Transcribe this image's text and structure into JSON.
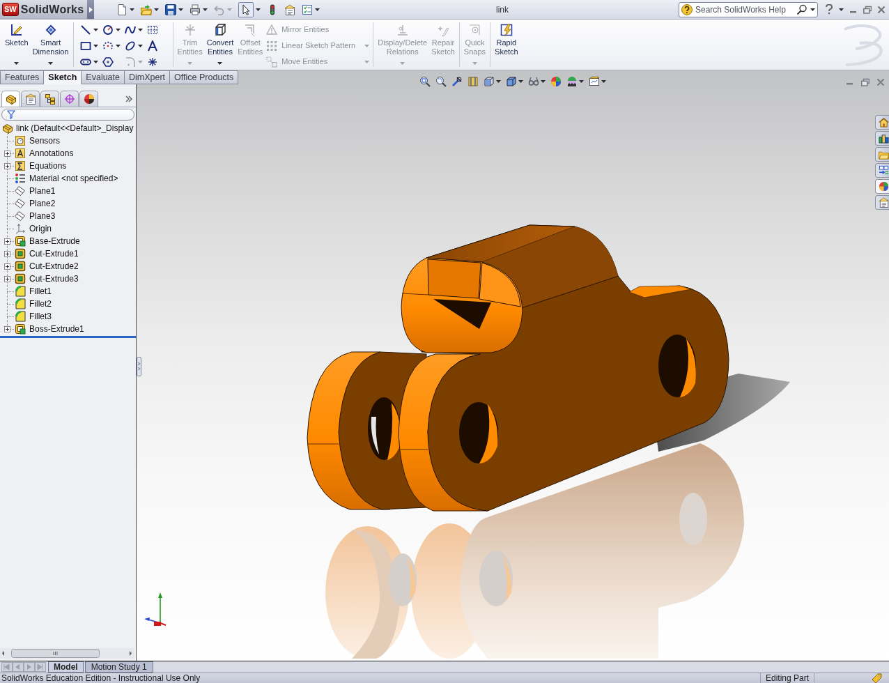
{
  "title_bar": {
    "logo_mark": "SW",
    "logo_text": "SolidWorks",
    "title": "link",
    "search": {
      "placeholder": "Search SolidWorks Help"
    }
  },
  "quick_access": [
    {
      "kind": "new",
      "menu": true,
      "disabled": false,
      "on": false
    },
    {
      "kind": "open",
      "menu": true,
      "disabled": false,
      "on": false
    },
    {
      "kind": "save",
      "menu": true,
      "disabled": false,
      "on": false
    },
    {
      "kind": "print",
      "menu": true,
      "disabled": false,
      "on": false
    },
    {
      "kind": "undo",
      "menu": true,
      "disabled": true,
      "on": false
    },
    {
      "kind": "select",
      "menu": true,
      "disabled": false,
      "on": true
    },
    {
      "kind": "rebuild",
      "menu": false,
      "disabled": false,
      "on": false
    },
    {
      "kind": "properties",
      "menu": false,
      "disabled": false,
      "on": false
    },
    {
      "kind": "options",
      "menu": true,
      "disabled": false,
      "on": false
    }
  ],
  "ribbon": {
    "sections": [
      {
        "kind": "buttons",
        "items": [
          {
            "kind": "sketch",
            "label": "Sketch",
            "disabled": false,
            "menu": true
          },
          {
            "kind": "dimension",
            "label": "Smart Dimension",
            "disabled": false,
            "menu": true
          }
        ]
      },
      {
        "kind": "tools",
        "items": [
          {
            "kind": "line",
            "disabled": false,
            "menu": true
          },
          {
            "kind": "circle",
            "disabled": false,
            "menu": true
          },
          {
            "kind": "spline",
            "disabled": false,
            "menu": true
          },
          {
            "kind": "grid",
            "disabled": false,
            "menu": false
          },
          {
            "kind": "rectangle",
            "disabled": false,
            "menu": true
          },
          {
            "kind": "arc",
            "disabled": false,
            "menu": true
          },
          {
            "kind": "ellipse",
            "disabled": false,
            "menu": true
          },
          {
            "kind": "text",
            "disabled": false,
            "menu": false
          },
          {
            "kind": "slot",
            "disabled": false,
            "menu": true
          },
          {
            "kind": "polygon",
            "disabled": false,
            "menu": false
          },
          {
            "kind": "fillet",
            "disabled": true,
            "menu": true
          },
          {
            "kind": "point",
            "disabled": false,
            "menu": false
          }
        ]
      },
      {
        "kind": "buttons",
        "items": [
          {
            "kind": "trim",
            "label": "Trim Entities",
            "disabled": true,
            "menu": true
          },
          {
            "kind": "convert",
            "label": "Convert Entities",
            "disabled": false,
            "menu": true
          },
          {
            "kind": "offset",
            "label": "Offset Entities",
            "disabled": true,
            "menu": false
          },
          {
            "kind": "stack",
            "items": [
              {
                "kind": "mirror",
                "label": "Mirror Entities",
                "disabled": true,
                "menu": false
              },
              {
                "kind": "pattern",
                "label": "Linear Sketch Pattern",
                "disabled": true,
                "menu": true
              },
              {
                "kind": "move",
                "label": "Move Entities",
                "disabled": true,
                "menu": true
              }
            ]
          }
        ]
      },
      {
        "kind": "buttons",
        "items": [
          {
            "kind": "relations",
            "label": "Display/Delete Relations",
            "disabled": true,
            "menu": true
          },
          {
            "kind": "repair",
            "label": "Repair Sketch",
            "disabled": true,
            "menu": false
          }
        ]
      },
      {
        "kind": "buttons",
        "items": [
          {
            "kind": "snaps",
            "label": "Quick Snaps",
            "disabled": true,
            "menu": true
          }
        ]
      },
      {
        "kind": "buttons",
        "items": [
          {
            "kind": "rapid",
            "label": "Rapid Sketch",
            "disabled": false,
            "menu": false
          }
        ]
      }
    ],
    "tabs": [
      {
        "label": "Features",
        "selected": false
      },
      {
        "label": "Sketch",
        "selected": true
      },
      {
        "label": "Evaluate",
        "selected": false
      },
      {
        "label": "DimXpert",
        "selected": false
      },
      {
        "label": "Office Products",
        "selected": false
      }
    ]
  },
  "view_toolbar": [
    {
      "kind": "zoomfit",
      "menu": false
    },
    {
      "kind": "zoomarea",
      "menu": false
    },
    {
      "kind": "previous",
      "menu": false
    },
    {
      "kind": "section",
      "menu": false
    },
    {
      "kind": "orientation",
      "menu": true
    },
    {
      "kind": "display",
      "menu": true
    },
    {
      "kind": "visibility",
      "menu": true
    },
    {
      "kind": "appearance",
      "menu": false
    },
    {
      "kind": "scene",
      "menu": true
    },
    {
      "kind": "settings",
      "menu": true
    }
  ],
  "feature_manager": {
    "tabs": [
      {
        "kind": "tree",
        "selected": true
      },
      {
        "kind": "properties",
        "selected": false
      },
      {
        "kind": "configurations",
        "selected": false
      },
      {
        "kind": "dimxpert",
        "selected": false
      },
      {
        "kind": "display",
        "selected": false
      }
    ],
    "tree": {
      "label": "link (Default<<Default>_Display",
      "kind": "part",
      "children": [
        {
          "label": "Sensors",
          "kind": "sensors",
          "expandable": false
        },
        {
          "label": "Annotations",
          "kind": "annotations",
          "expandable": true
        },
        {
          "label": "Equations",
          "kind": "equations",
          "expandable": true
        },
        {
          "label": "Material <not specified>",
          "kind": "material",
          "expandable": false
        },
        {
          "label": "Plane1",
          "kind": "plane",
          "expandable": false
        },
        {
          "label": "Plane2",
          "kind": "plane",
          "expandable": false
        },
        {
          "label": "Plane3",
          "kind": "plane",
          "expandable": false
        },
        {
          "label": "Origin",
          "kind": "origin",
          "expandable": false
        },
        {
          "label": "Base-Extrude",
          "kind": "extrude",
          "expandable": true
        },
        {
          "label": "Cut-Extrude1",
          "kind": "cut",
          "expandable": true
        },
        {
          "label": "Cut-Extrude2",
          "kind": "cut",
          "expandable": true
        },
        {
          "label": "Cut-Extrude3",
          "kind": "cut",
          "expandable": true
        },
        {
          "label": "Fillet1",
          "kind": "fillet",
          "expandable": false
        },
        {
          "label": "Fillet2",
          "kind": "fillet",
          "expandable": false
        },
        {
          "label": "Fillet3",
          "kind": "fillet",
          "expandable": false
        },
        {
          "label": "Boss-Extrude1",
          "kind": "extrude",
          "expandable": true
        }
      ]
    }
  },
  "task_pane": [
    {
      "kind": "home",
      "selected": false
    },
    {
      "kind": "library",
      "selected": false
    },
    {
      "kind": "explorer",
      "selected": false
    },
    {
      "kind": "palette",
      "selected": false
    },
    {
      "kind": "appearances",
      "selected": true
    },
    {
      "kind": "properties",
      "selected": false
    }
  ],
  "bottom_tabs": [
    {
      "label": "Model",
      "selected": true
    },
    {
      "label": "Motion Study 1",
      "selected": false
    }
  ],
  "status_bar": {
    "message": "SolidWorks Education Edition - Instructional Use Only",
    "mode": "Editing Part"
  }
}
